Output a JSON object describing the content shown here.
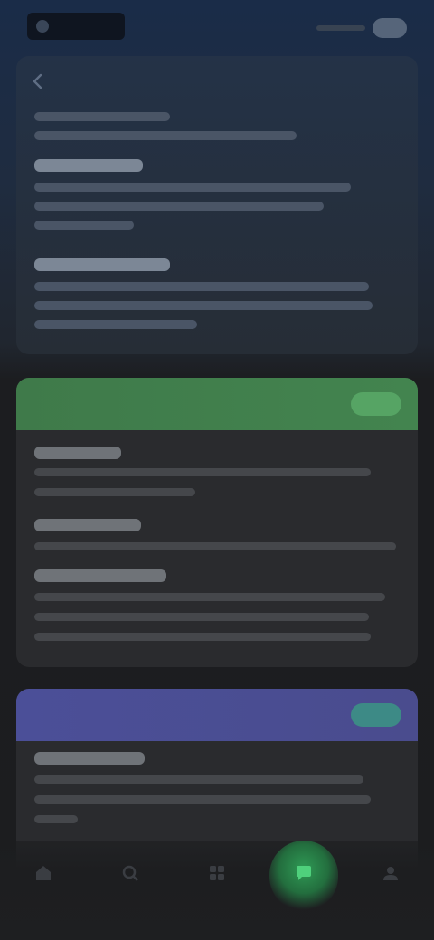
{
  "status_bar": {
    "brand": "",
    "right_text": ""
  },
  "header": {
    "title": ""
  },
  "sections": {
    "green_card_label": "",
    "purple_card_label": ""
  },
  "nav": {
    "items": [
      {
        "label": "",
        "icon": "home-icon"
      },
      {
        "label": "",
        "icon": "search-icon"
      },
      {
        "label": "",
        "icon": "grid-icon"
      },
      {
        "label": "",
        "icon": "chat-icon",
        "active": true
      },
      {
        "label": "",
        "icon": "profile-icon"
      }
    ]
  },
  "colors": {
    "accent_green": "#43844f",
    "accent_purple": "#4b4f98",
    "badge_teal": "#3d8a86",
    "active_nav": "#2f9a55"
  }
}
